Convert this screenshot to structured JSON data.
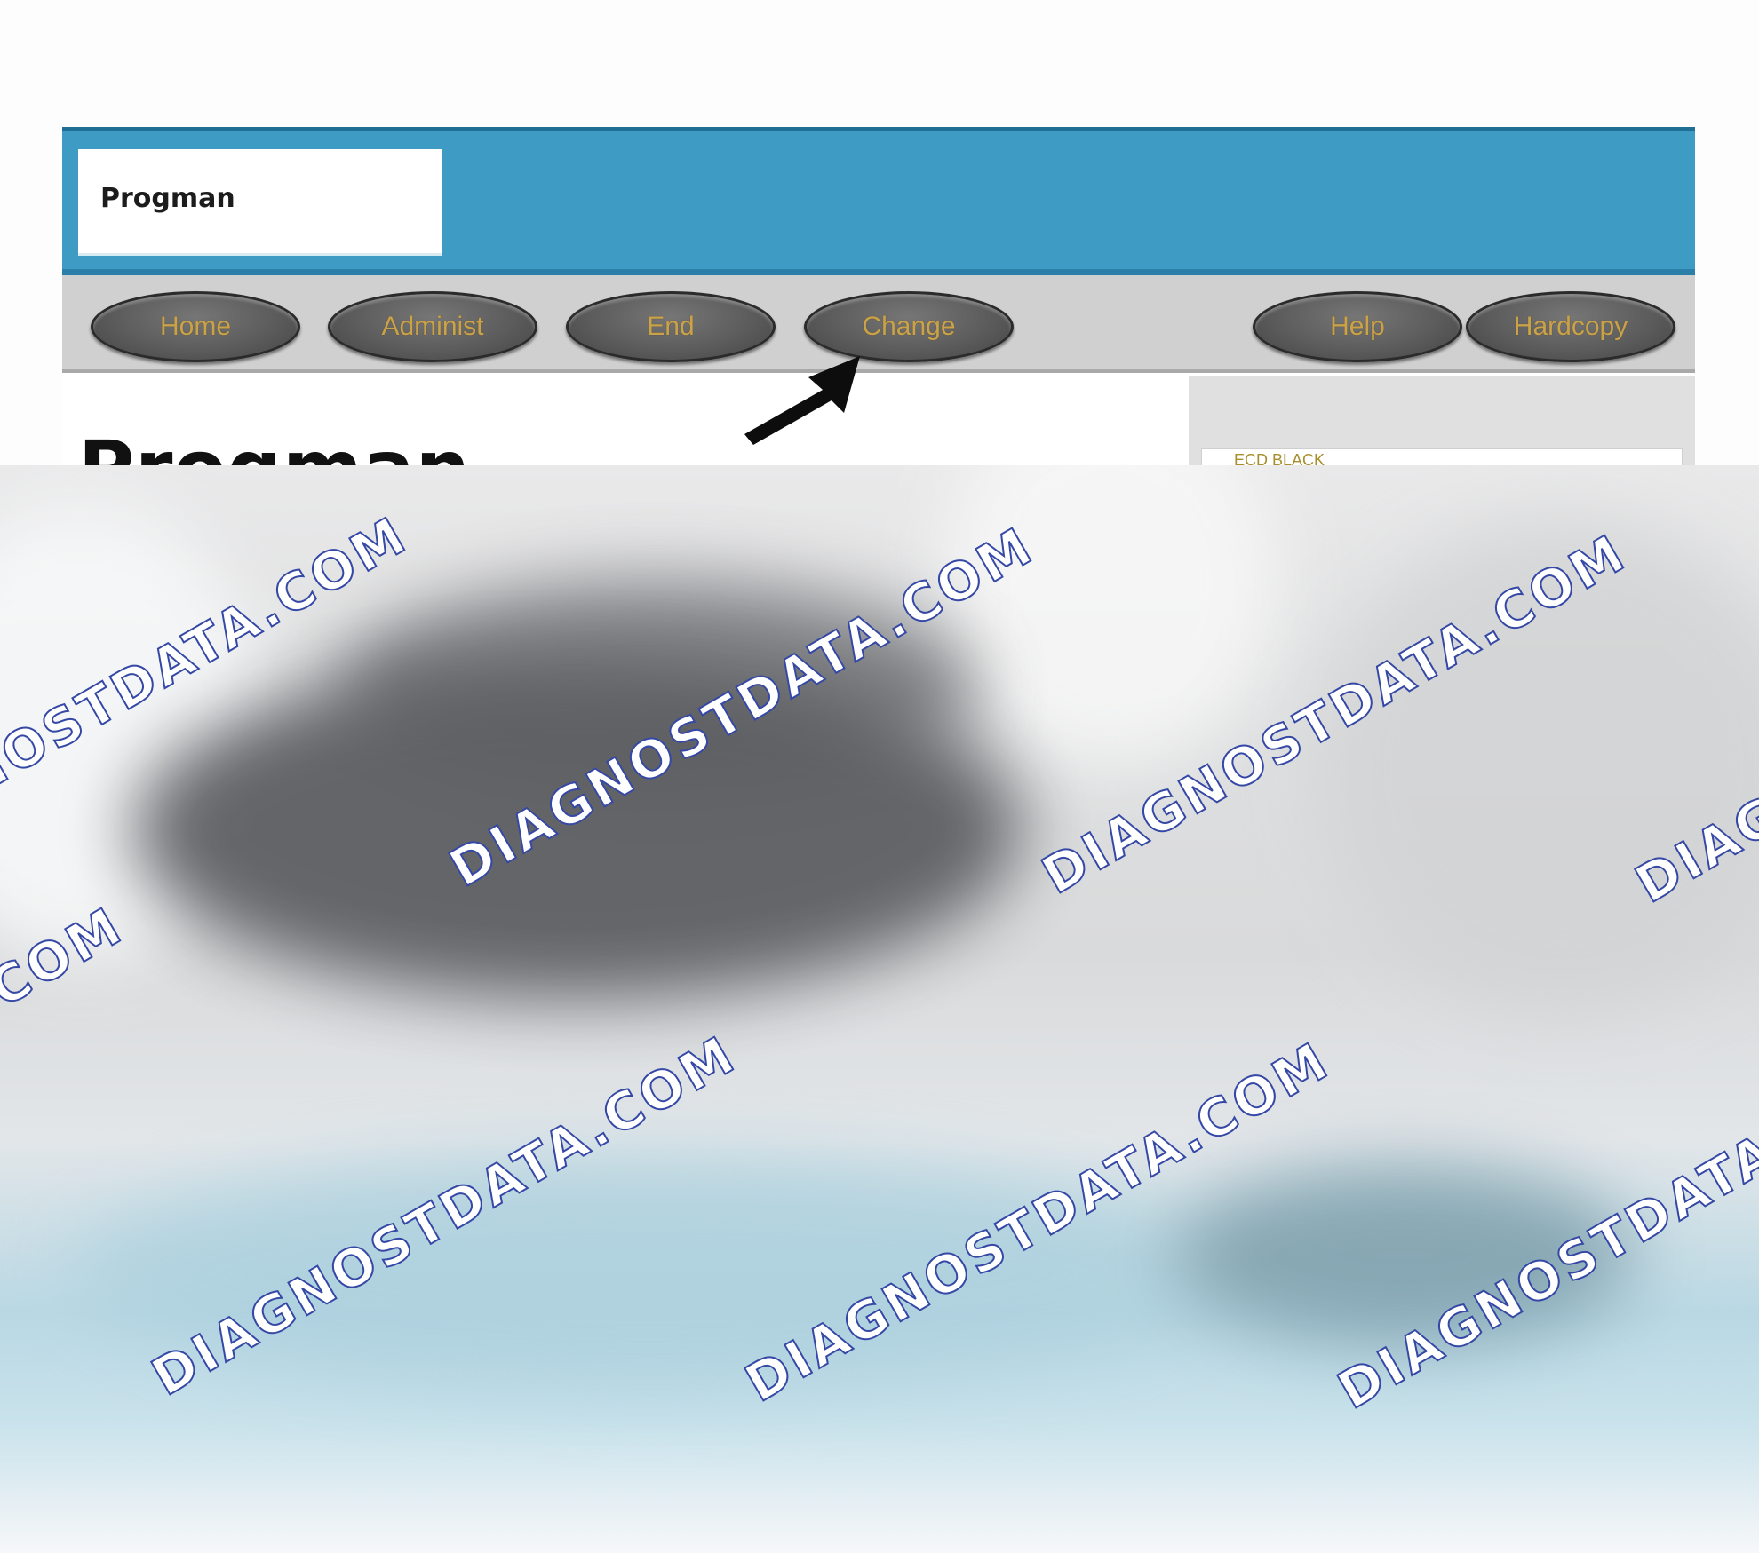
{
  "app": {
    "title": "Progman",
    "page_heading": "Progman",
    "side_panel_text": "ECD BLACK"
  },
  "nav": {
    "buttons": [
      {
        "label": "Home"
      },
      {
        "label": "Administ"
      },
      {
        "label": "End"
      },
      {
        "label": "Change"
      },
      {
        "label": "Help"
      },
      {
        "label": "Hardcopy"
      }
    ]
  },
  "watermark": {
    "text": "DIAGNOSTDATA.COM",
    "fill_color": "#ffffff",
    "stroke_color": "#3548a6"
  },
  "colors": {
    "header_blue": "#3e9cc4",
    "nav_gray": "#d0d0d0",
    "button_dark": "#5c5c5c",
    "button_text_gold": "#c9a24a"
  },
  "icons": {
    "pointer": "arrow-pointer-icon"
  }
}
